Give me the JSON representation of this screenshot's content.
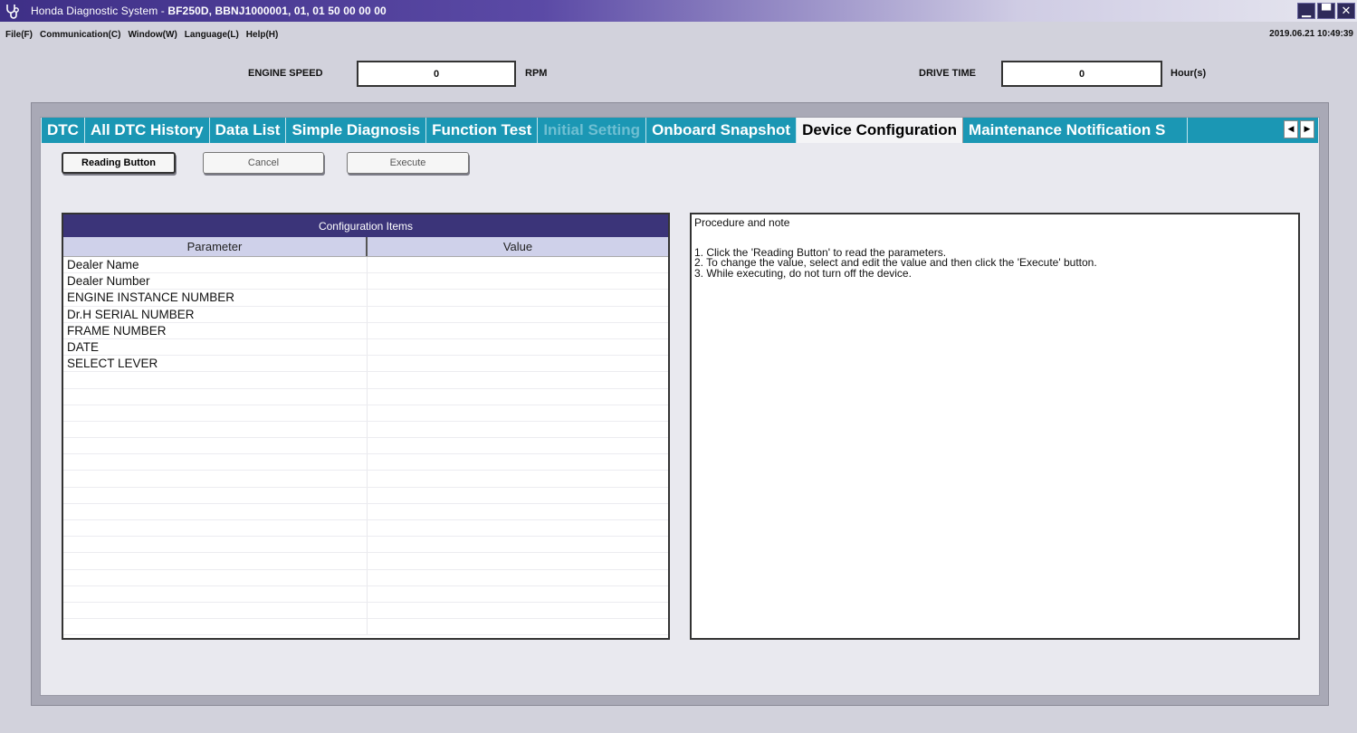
{
  "window": {
    "title_prefix": "Honda Diagnostic System - ",
    "title_detail": "BF250D, BBNJ1000001, 01,  01 50 00 00 00",
    "minimize_glyph": "▁",
    "maximize_glyph": "▀",
    "close_glyph": "✕"
  },
  "menu": {
    "items": [
      "File(F)",
      "Communication(C)",
      "Window(W)",
      "Language(L)",
      "Help(H)"
    ],
    "clock": "2019.06.21  10:49:39"
  },
  "readouts": {
    "engine_speed": {
      "label": "ENGINE SPEED",
      "value": "0",
      "unit": "RPM"
    },
    "drive_time": {
      "label": "DRIVE TIME",
      "value": "0",
      "unit": "Hour(s)"
    }
  },
  "tabs": {
    "items": [
      {
        "label": "DTC",
        "state": "normal"
      },
      {
        "label": "All DTC History",
        "state": "normal"
      },
      {
        "label": "Data List",
        "state": "normal"
      },
      {
        "label": "Simple Diagnosis",
        "state": "normal"
      },
      {
        "label": "Function Test",
        "state": "normal"
      },
      {
        "label": "Initial Setting",
        "state": "disabled"
      },
      {
        "label": "Onboard Snapshot",
        "state": "normal"
      },
      {
        "label": "Device Configuration",
        "state": "active"
      },
      {
        "label": "Maintenance Notification S",
        "state": "clipped"
      }
    ],
    "scroll_left_glyph": "◀",
    "scroll_right_glyph": "▶"
  },
  "toolbar": {
    "reading_label": "Reading Button",
    "cancel_label": "Cancel",
    "execute_label": "Execute"
  },
  "config": {
    "header": "Configuration Items",
    "col_parameter": "Parameter",
    "col_value": "Value",
    "rows": [
      {
        "parameter": "Dealer Name",
        "value": ""
      },
      {
        "parameter": "Dealer Number",
        "value": ""
      },
      {
        "parameter": "ENGINE INSTANCE NUMBER",
        "value": ""
      },
      {
        "parameter": "Dr.H SERIAL NUMBER",
        "value": ""
      },
      {
        "parameter": "FRAME NUMBER",
        "value": ""
      },
      {
        "parameter": "DATE",
        "value": ""
      },
      {
        "parameter": "SELECT LEVER",
        "value": ""
      }
    ]
  },
  "notes": {
    "title": "Procedure and note",
    "lines": [
      "1. Click the 'Reading Button' to read the parameters.",
      "2. To change the value, select and edit the value and then click the 'Execute' button.",
      "3. While executing, do not turn off the device."
    ]
  }
}
